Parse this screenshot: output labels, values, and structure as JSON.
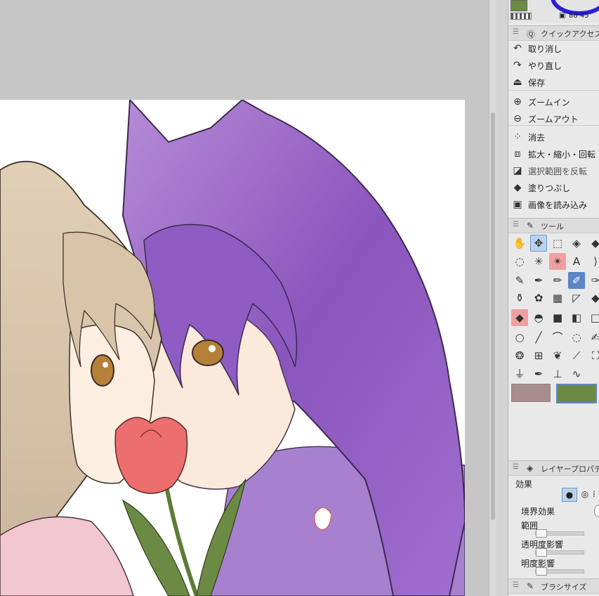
{
  "color_status": {
    "readout": "88 45",
    "swatch_color": "#6b8a44"
  },
  "quick_access": {
    "title": "クイックアクセス",
    "items": [
      {
        "label": "取り消し",
        "icon": "undo-icon",
        "glyph": "↶"
      },
      {
        "label": "やり直し",
        "icon": "redo-icon",
        "glyph": "↷"
      },
      {
        "label": "保存",
        "icon": "save-icon",
        "glyph": "⏏"
      },
      {
        "label": "ズームイン",
        "icon": "zoom-in-icon",
        "glyph": "⊕"
      },
      {
        "label": "ズームアウト",
        "icon": "zoom-out-icon",
        "glyph": "⊖"
      },
      {
        "label": "消去",
        "icon": "clear-icon",
        "glyph": "⁘"
      },
      {
        "label": "拡大・縮小・回転",
        "icon": "transform-icon",
        "glyph": "⧈"
      },
      {
        "label": "選択範囲を反転",
        "icon": "invert-selection-icon",
        "glyph": "◪"
      },
      {
        "label": "塗りつぶし",
        "icon": "fill-icon",
        "glyph": "◆"
      },
      {
        "label": "画像を読み込み",
        "icon": "import-image-icon",
        "glyph": "▣"
      }
    ]
  },
  "tool_panel": {
    "title": "ツール",
    "tools": [
      {
        "name": "hand-tool-icon",
        "glyph": "✋",
        "state": ""
      },
      {
        "name": "move-tool-icon",
        "glyph": "✥",
        "state": "blue"
      },
      {
        "name": "object-tool-icon",
        "glyph": "⬚",
        "state": ""
      },
      {
        "name": "layer-move-icon",
        "glyph": "◈",
        "state": ""
      },
      {
        "name": "eraser-tool-icon",
        "glyph": "◆",
        "state": ""
      },
      {
        "name": "lasso-tool-icon",
        "glyph": "◌",
        "state": ""
      },
      {
        "name": "auto-select-icon",
        "glyph": "✳",
        "state": ""
      },
      {
        "name": "sparkle-tool-icon",
        "glyph": "✴",
        "state": "red"
      },
      {
        "name": "text-tool-icon",
        "glyph": "A",
        "state": ""
      },
      {
        "name": "balloon-tool-icon",
        "glyph": "⟩",
        "state": ""
      },
      {
        "name": "eyedropper-tool-icon",
        "glyph": "✎",
        "state": ""
      },
      {
        "name": "pen-tool-icon",
        "glyph": "✒",
        "state": ""
      },
      {
        "name": "pencil-tool-icon",
        "glyph": "✏",
        "state": ""
      },
      {
        "name": "brush-tool-icon",
        "glyph": "✐",
        "state": "dblue"
      },
      {
        "name": "airbrush-tool-icon",
        "glyph": "✑",
        "state": ""
      },
      {
        "name": "decoration-tool-icon",
        "glyph": "⚱",
        "state": ""
      },
      {
        "name": "blend-tool-icon",
        "glyph": "✿",
        "state": ""
      },
      {
        "name": "pattern-tool-icon",
        "glyph": "▦",
        "state": ""
      },
      {
        "name": "ruler-tool-icon",
        "glyph": "◸",
        "state": ""
      },
      {
        "name": "fill-tool-icon",
        "glyph": "◆",
        "state": ""
      },
      {
        "name": "fill-ref-tool-icon",
        "glyph": "◆",
        "state": "red"
      },
      {
        "name": "cake-tool-icon",
        "glyph": "◓",
        "state": ""
      },
      {
        "name": "gradient-tool-icon",
        "glyph": "■",
        "state": ""
      },
      {
        "name": "gradient2-tool-icon",
        "glyph": "◧",
        "state": ""
      },
      {
        "name": "rect-tool-icon",
        "glyph": "□",
        "state": ""
      },
      {
        "name": "ellipse-tool-icon",
        "glyph": "○",
        "state": ""
      },
      {
        "name": "line-tool-icon",
        "glyph": "╱",
        "state": ""
      },
      {
        "name": "curve-tool-icon",
        "glyph": "⌒",
        "state": ""
      },
      {
        "name": "dotted-circle-icon",
        "glyph": "◌",
        "state": ""
      },
      {
        "name": "smudge-tool-icon",
        "glyph": "✍",
        "state": ""
      },
      {
        "name": "drops-tool-icon",
        "glyph": "❂",
        "state": ""
      },
      {
        "name": "mesh-tool-icon",
        "glyph": "⊞",
        "state": ""
      },
      {
        "name": "feather-tool-icon",
        "glyph": "❦",
        "state": ""
      },
      {
        "name": "dropper-tool-icon",
        "glyph": "⟋",
        "state": ""
      },
      {
        "name": "bucket-tool-icon",
        "glyph": "⛶",
        "state": ""
      },
      {
        "name": "lamp-tool-icon",
        "glyph": "⏚",
        "state": ""
      },
      {
        "name": "nib-tool-icon",
        "glyph": "✒",
        "state": ""
      },
      {
        "name": "stamp-tool-icon",
        "glyph": "⊥",
        "state": ""
      },
      {
        "name": "wave-tool-icon",
        "glyph": "∿",
        "state": ""
      }
    ],
    "main_color": "#a98c8c",
    "sub_color": "#6b8a44"
  },
  "layer_properties": {
    "title": "レイヤープロパティ",
    "effect_label": "効果",
    "border_effect_label": "境界効果",
    "range_label": "範囲",
    "opacity_influence_label": "透明度影響",
    "brightness_influence_label": "明度影響"
  },
  "brush_size": {
    "title": "ブラシサイズ"
  }
}
